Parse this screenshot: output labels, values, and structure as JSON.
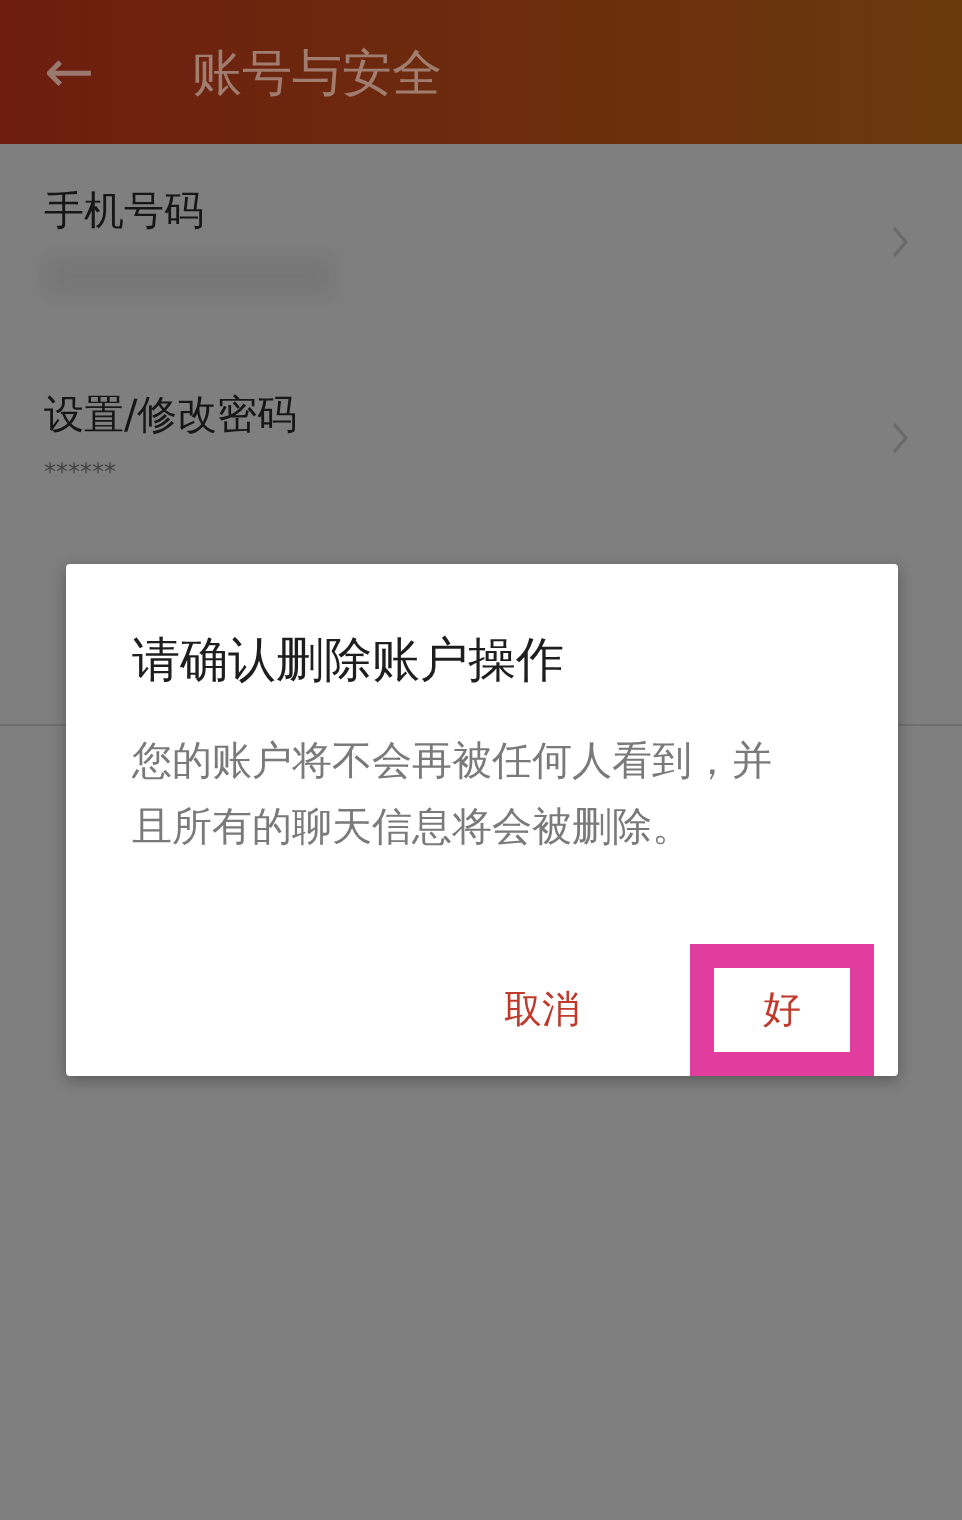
{
  "header": {
    "back_icon": "←",
    "title": "账号与安全"
  },
  "items": [
    {
      "title": "手机号码",
      "kind": "redacted"
    },
    {
      "title": "设置/修改密码",
      "value": "******",
      "kind": "value"
    }
  ],
  "dialog": {
    "title": "请确认删除账户操作",
    "message": "您的账户将不会再被任何人看到，并且所有的聊天信息将会被删除。",
    "buttons": [
      {
        "label": "取消",
        "highlighted": false
      },
      {
        "label": "好",
        "highlighted": true
      }
    ]
  }
}
